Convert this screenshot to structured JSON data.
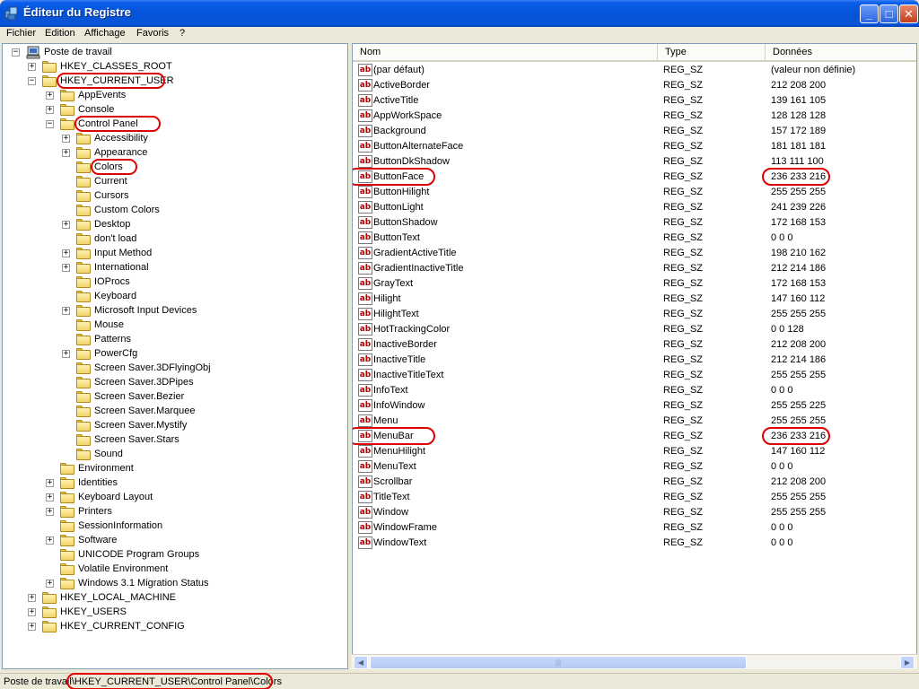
{
  "window": {
    "title": "Éditeur du Registre",
    "min_glyph": "_",
    "max_glyph": "□",
    "close_glyph": "✕"
  },
  "menu": [
    "Fichier",
    "Edition",
    "Affichage",
    "Favoris",
    "?"
  ],
  "tree": [
    {
      "label": "Poste de travail",
      "level": 0,
      "expander": "−",
      "icon": "computer"
    },
    {
      "label": "HKEY_CLASSES_ROOT",
      "level": 1,
      "expander": "+"
    },
    {
      "label": "HKEY_CURRENT_USER",
      "level": 1,
      "expander": "−",
      "highlight": true
    },
    {
      "label": "AppEvents",
      "level": 2,
      "expander": "+"
    },
    {
      "label": "Console",
      "level": 2,
      "expander": "+"
    },
    {
      "label": "Control Panel",
      "level": 2,
      "expander": "−",
      "highlight": true
    },
    {
      "label": "Accessibility",
      "level": 3,
      "expander": "+"
    },
    {
      "label": "Appearance",
      "level": 3,
      "expander": "+"
    },
    {
      "label": "Colors",
      "level": 3,
      "expander": "",
      "highlight": true,
      "selected": true
    },
    {
      "label": "Current",
      "level": 3,
      "expander": ""
    },
    {
      "label": "Cursors",
      "level": 3,
      "expander": ""
    },
    {
      "label": "Custom Colors",
      "level": 3,
      "expander": ""
    },
    {
      "label": "Desktop",
      "level": 3,
      "expander": "+"
    },
    {
      "label": "don't load",
      "level": 3,
      "expander": ""
    },
    {
      "label": "Input Method",
      "level": 3,
      "expander": "+"
    },
    {
      "label": "International",
      "level": 3,
      "expander": "+"
    },
    {
      "label": "IOProcs",
      "level": 3,
      "expander": ""
    },
    {
      "label": "Keyboard",
      "level": 3,
      "expander": ""
    },
    {
      "label": "Microsoft Input Devices",
      "level": 3,
      "expander": "+"
    },
    {
      "label": "Mouse",
      "level": 3,
      "expander": ""
    },
    {
      "label": "Patterns",
      "level": 3,
      "expander": ""
    },
    {
      "label": "PowerCfg",
      "level": 3,
      "expander": "+"
    },
    {
      "label": "Screen Saver.3DFlyingObj",
      "level": 3,
      "expander": ""
    },
    {
      "label": "Screen Saver.3DPipes",
      "level": 3,
      "expander": ""
    },
    {
      "label": "Screen Saver.Bezier",
      "level": 3,
      "expander": ""
    },
    {
      "label": "Screen Saver.Marquee",
      "level": 3,
      "expander": ""
    },
    {
      "label": "Screen Saver.Mystify",
      "level": 3,
      "expander": ""
    },
    {
      "label": "Screen Saver.Stars",
      "level": 3,
      "expander": ""
    },
    {
      "label": "Sound",
      "level": 3,
      "expander": ""
    },
    {
      "label": "Environment",
      "level": 2,
      "expander": ""
    },
    {
      "label": "Identities",
      "level": 2,
      "expander": "+"
    },
    {
      "label": "Keyboard Layout",
      "level": 2,
      "expander": "+"
    },
    {
      "label": "Printers",
      "level": 2,
      "expander": "+"
    },
    {
      "label": "SessionInformation",
      "level": 2,
      "expander": ""
    },
    {
      "label": "Software",
      "level": 2,
      "expander": "+"
    },
    {
      "label": "UNICODE Program Groups",
      "level": 2,
      "expander": ""
    },
    {
      "label": "Volatile Environment",
      "level": 2,
      "expander": ""
    },
    {
      "label": "Windows 3.1 Migration Status",
      "level": 2,
      "expander": "+"
    },
    {
      "label": "HKEY_LOCAL_MACHINE",
      "level": 1,
      "expander": "+"
    },
    {
      "label": "HKEY_USERS",
      "level": 1,
      "expander": "+"
    },
    {
      "label": "HKEY_CURRENT_CONFIG",
      "level": 1,
      "expander": "+"
    }
  ],
  "list": {
    "columns": [
      "Nom",
      "Type",
      "Données"
    ],
    "icon_text": "ab",
    "rows": [
      {
        "name": "(par défaut)",
        "type": "REG_SZ",
        "data": "(valeur non définie)"
      },
      {
        "name": "ActiveBorder",
        "type": "REG_SZ",
        "data": "212 208 200"
      },
      {
        "name": "ActiveTitle",
        "type": "REG_SZ",
        "data": "139 161 105"
      },
      {
        "name": "AppWorkSpace",
        "type": "REG_SZ",
        "data": "128 128 128"
      },
      {
        "name": "Background",
        "type": "REG_SZ",
        "data": "157 172 189"
      },
      {
        "name": "ButtonAlternateFace",
        "type": "REG_SZ",
        "data": "181 181 181"
      },
      {
        "name": "ButtonDkShadow",
        "type": "REG_SZ",
        "data": "113 111 100"
      },
      {
        "name": "ButtonFace",
        "type": "REG_SZ",
        "data": "236 233 216",
        "highlight": true
      },
      {
        "name": "ButtonHilight",
        "type": "REG_SZ",
        "data": "255 255 255"
      },
      {
        "name": "ButtonLight",
        "type": "REG_SZ",
        "data": "241 239 226"
      },
      {
        "name": "ButtonShadow",
        "type": "REG_SZ",
        "data": "172 168 153"
      },
      {
        "name": "ButtonText",
        "type": "REG_SZ",
        "data": "0 0 0"
      },
      {
        "name": "GradientActiveTitle",
        "type": "REG_SZ",
        "data": "198 210 162"
      },
      {
        "name": "GradientInactiveTitle",
        "type": "REG_SZ",
        "data": "212 214 186"
      },
      {
        "name": "GrayText",
        "type": "REG_SZ",
        "data": "172 168 153"
      },
      {
        "name": "Hilight",
        "type": "REG_SZ",
        "data": "147 160 112"
      },
      {
        "name": "HilightText",
        "type": "REG_SZ",
        "data": "255 255 255"
      },
      {
        "name": "HotTrackingColor",
        "type": "REG_SZ",
        "data": "0 0 128"
      },
      {
        "name": "InactiveBorder",
        "type": "REG_SZ",
        "data": "212 208 200"
      },
      {
        "name": "InactiveTitle",
        "type": "REG_SZ",
        "data": "212 214 186"
      },
      {
        "name": "InactiveTitleText",
        "type": "REG_SZ",
        "data": "255 255 255"
      },
      {
        "name": "InfoText",
        "type": "REG_SZ",
        "data": "0 0 0"
      },
      {
        "name": "InfoWindow",
        "type": "REG_SZ",
        "data": "255 255 225"
      },
      {
        "name": "Menu",
        "type": "REG_SZ",
        "data": "255 255 255"
      },
      {
        "name": "MenuBar",
        "type": "REG_SZ",
        "data": "236 233 216",
        "highlight": true
      },
      {
        "name": "MenuHilight",
        "type": "REG_SZ",
        "data": "147 160 112"
      },
      {
        "name": "MenuText",
        "type": "REG_SZ",
        "data": "0 0 0"
      },
      {
        "name": "Scrollbar",
        "type": "REG_SZ",
        "data": "212 208 200"
      },
      {
        "name": "TitleText",
        "type": "REG_SZ",
        "data": "255 255 255"
      },
      {
        "name": "Window",
        "type": "REG_SZ",
        "data": "255 255 255"
      },
      {
        "name": "WindowFrame",
        "type": "REG_SZ",
        "data": "0 0 0"
      },
      {
        "name": "WindowText",
        "type": "REG_SZ",
        "data": "0 0 0"
      }
    ]
  },
  "statusbar": {
    "prefix": "Poste de travail",
    "path": "\\HKEY_CURRENT_USER\\Control Panel\\Colors"
  },
  "scroll": {
    "left_glyph": "◀",
    "right_glyph": "▶",
    "grip": "|||"
  },
  "colors": {
    "highlight": "#e00000",
    "title_blue": "#0453d8",
    "face": "#ece9d8"
  }
}
